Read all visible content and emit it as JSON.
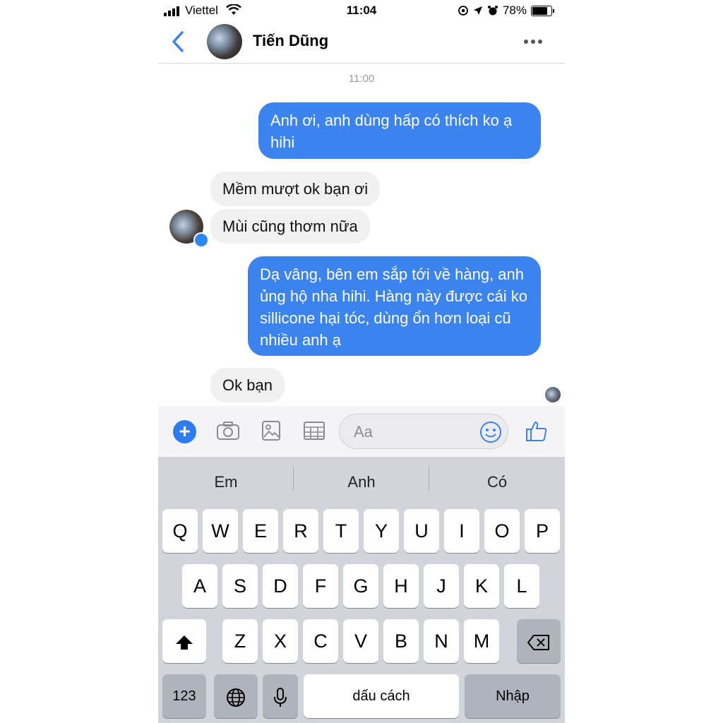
{
  "status_bar": {
    "carrier": "Viettel",
    "time": "11:04",
    "battery": "78%"
  },
  "header": {
    "contact_name": "Tiến Dũng"
  },
  "chat": {
    "timestamp": "11:00",
    "messages": [
      {
        "dir": "out",
        "text": "Anh ơi, anh dùng hấp có thích ko ạ hihi"
      },
      {
        "dir": "in",
        "text": "Mềm mượt ok bạn ơi"
      },
      {
        "dir": "in",
        "text": "Mùi cũng thơm nữa"
      },
      {
        "dir": "out",
        "text": "Dạ vâng, bên em sắp tới về hàng, anh ủng hộ nha hihi. Hàng này được cái ko sillicone hại tóc, dùng ổn hơn loại cũ nhiều anh ạ"
      },
      {
        "dir": "in",
        "text": "Ok bạn"
      }
    ]
  },
  "composer": {
    "placeholder": "Aa"
  },
  "keyboard": {
    "suggestions": [
      "Em",
      "Anh",
      "Có"
    ],
    "row1": [
      "Q",
      "W",
      "E",
      "R",
      "T",
      "Y",
      "U",
      "I",
      "O",
      "P"
    ],
    "row2": [
      "A",
      "S",
      "D",
      "F",
      "G",
      "H",
      "J",
      "K",
      "L"
    ],
    "row3": [
      "Z",
      "X",
      "C",
      "V",
      "B",
      "N",
      "M"
    ],
    "numbers_label": "123",
    "space_label": "dấu cách",
    "return_label": "Nhập"
  }
}
